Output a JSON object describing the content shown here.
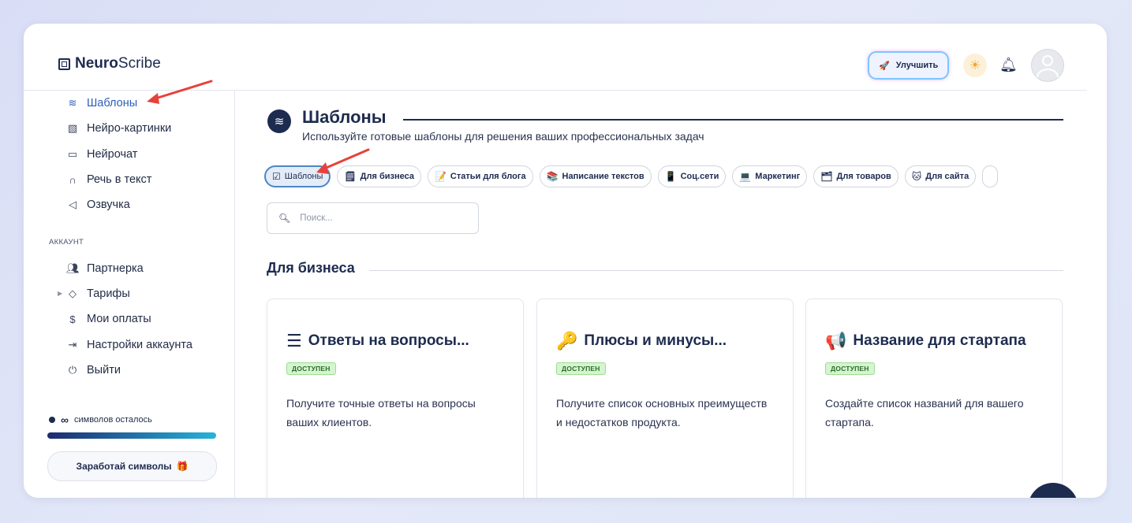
{
  "app": {
    "logo_bold": "Neuro",
    "logo_regular": "Scribe"
  },
  "header": {
    "upgrade_label": "Улучшить"
  },
  "sidebar": {
    "items": [
      {
        "label": "Шаблоны",
        "icon": "layers-icon"
      },
      {
        "label": "Нейро-картинки",
        "icon": "image-icon"
      },
      {
        "label": "Нейрочат",
        "icon": "chat-icon"
      },
      {
        "label": "Речь в текст",
        "icon": "headphones-icon"
      },
      {
        "label": "Озвучка",
        "icon": "speaker-icon"
      }
    ],
    "account_label": "АККАУНТ",
    "account_items": [
      {
        "label": "Партнерка",
        "icon": "users-icon"
      },
      {
        "label": "Тарифы",
        "icon": "tag-icon"
      },
      {
        "label": "Мои оплаты",
        "icon": "dollar-icon"
      },
      {
        "label": "Настройки аккаунта",
        "icon": "login-icon"
      },
      {
        "label": "Выйти",
        "icon": "power-icon"
      }
    ],
    "symbols_value": "∞",
    "symbols_label": "символов осталось",
    "symbols_progress": 1.0,
    "earn_label": "Заработай символы"
  },
  "main": {
    "title": "Шаблоны",
    "subtitle": "Используйте готовые шаблоны для решения ваших профессиональных задач",
    "chips": [
      {
        "emoji": "☑",
        "label": "Шаблоны"
      },
      {
        "emoji": "🗒",
        "label": "Для бизнеса"
      },
      {
        "emoji": "📝",
        "label": "Статьи для блога"
      },
      {
        "emoji": "📚",
        "label": "Написание текстов"
      },
      {
        "emoji": "📱",
        "label": "Соц.сети"
      },
      {
        "emoji": "💻",
        "label": "Маркетинг"
      },
      {
        "emoji": "🗂",
        "label": "Для товаров"
      },
      {
        "emoji": "🐱",
        "label": "Для сайта"
      }
    ],
    "search_placeholder": "Поиск...",
    "section_title": "Для бизнеса",
    "cards": [
      {
        "title": "Ответы на вопросы...",
        "badge": "ДОСТУПЕН",
        "desc": "Получите точные ответы на вопросы ваших клиентов.",
        "icon": "list-icon"
      },
      {
        "title": "Плюсы и минусы...",
        "badge": "ДОСТУПЕН",
        "desc": "Получите список основных преимуществ и недостатков продукта.",
        "icon": "key-icon"
      },
      {
        "title": "Название для стартапа",
        "badge": "ДОСТУПЕН",
        "desc": "Создайте список названий для вашего стартапа.",
        "icon": "megaphone-icon"
      }
    ]
  }
}
